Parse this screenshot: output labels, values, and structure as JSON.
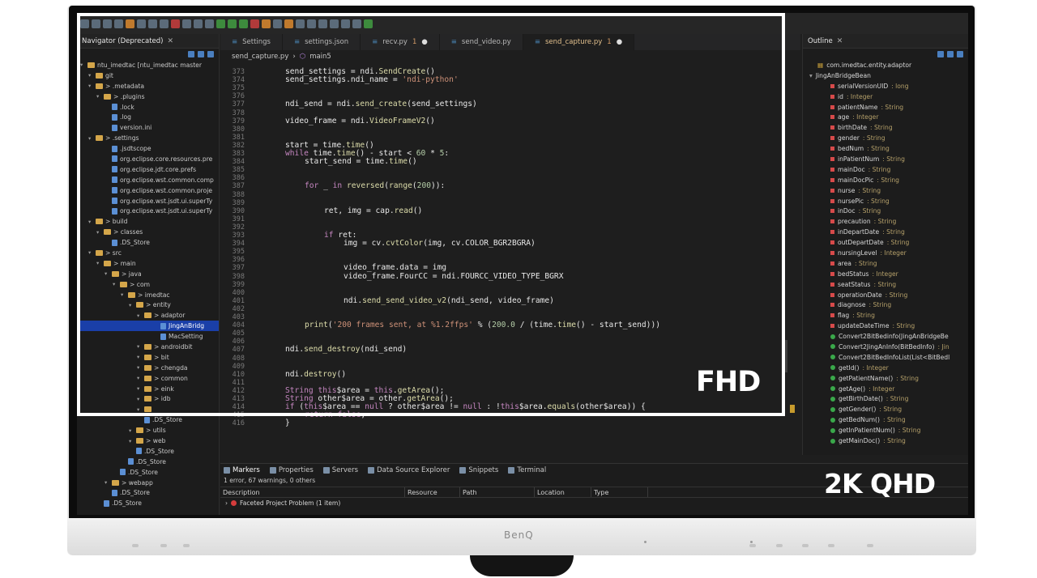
{
  "navigator": {
    "title": "Navigator (Deprecated)",
    "items": [
      {
        "label": "ntu_imedtac [ntu_imedtac master",
        "indent": 0,
        "kind": "project"
      },
      {
        "label": "git",
        "indent": 1,
        "kind": "folder"
      },
      {
        "label": "> .metadata",
        "indent": 1,
        "kind": "folder"
      },
      {
        "label": "> .plugins",
        "indent": 2,
        "kind": "folder"
      },
      {
        "label": ".lock",
        "indent": 3,
        "kind": "file"
      },
      {
        "label": ".log",
        "indent": 3,
        "kind": "file"
      },
      {
        "label": "version.ini",
        "indent": 3,
        "kind": "file"
      },
      {
        "label": "> .settings",
        "indent": 1,
        "kind": "folder"
      },
      {
        "label": ".jsdtscope",
        "indent": 3,
        "kind": "file"
      },
      {
        "label": "org.eclipse.core.resources.pre",
        "indent": 3,
        "kind": "file"
      },
      {
        "label": "org.eclipse.jdt.core.prefs",
        "indent": 3,
        "kind": "file"
      },
      {
        "label": "org.eclipse.wst.common.comp",
        "indent": 3,
        "kind": "file"
      },
      {
        "label": "org.eclipse.wst.common.proje",
        "indent": 3,
        "kind": "file"
      },
      {
        "label": "org.eclipse.wst.jsdt.ui.superTy",
        "indent": 3,
        "kind": "file"
      },
      {
        "label": "org.eclipse.wst.jsdt.ui.superTy",
        "indent": 3,
        "kind": "file"
      },
      {
        "label": "> build",
        "indent": 1,
        "kind": "folder"
      },
      {
        "label": "> classes",
        "indent": 2,
        "kind": "folder"
      },
      {
        "label": ".DS_Store",
        "indent": 3,
        "kind": "file"
      },
      {
        "label": "> src",
        "indent": 1,
        "kind": "folder"
      },
      {
        "label": "> main",
        "indent": 2,
        "kind": "folder"
      },
      {
        "label": "> java",
        "indent": 3,
        "kind": "folder"
      },
      {
        "label": "> com",
        "indent": 4,
        "kind": "folder"
      },
      {
        "label": "> imedtac",
        "indent": 5,
        "kind": "folder"
      },
      {
        "label": "> entity",
        "indent": 6,
        "kind": "folder"
      },
      {
        "label": "> adaptor",
        "indent": 7,
        "kind": "folder"
      },
      {
        "label": "JingAnBridg",
        "indent": 9,
        "kind": "file",
        "selected": true
      },
      {
        "label": "MacSetting",
        "indent": 9,
        "kind": "file"
      },
      {
        "label": "> androidbit",
        "indent": 7,
        "kind": "folder"
      },
      {
        "label": "> bit",
        "indent": 7,
        "kind": "folder"
      },
      {
        "label": "> chengda",
        "indent": 7,
        "kind": "folder"
      },
      {
        "label": "> common",
        "indent": 7,
        "kind": "folder"
      },
      {
        "label": "> eink",
        "indent": 7,
        "kind": "folder"
      },
      {
        "label": "> idb",
        "indent": 7,
        "kind": "folder"
      },
      {
        "label": "",
        "indent": 7,
        "kind": "folder"
      },
      {
        "label": ".DS_Store",
        "indent": 7,
        "kind": "file"
      },
      {
        "label": "> utils",
        "indent": 6,
        "kind": "folder"
      },
      {
        "label": "> web",
        "indent": 6,
        "kind": "folder"
      },
      {
        "label": ".DS_Store",
        "indent": 6,
        "kind": "file"
      },
      {
        "label": ".DS_Store",
        "indent": 5,
        "kind": "file"
      },
      {
        "label": ".DS_Store",
        "indent": 4,
        "kind": "file"
      },
      {
        "label": "> webapp",
        "indent": 3,
        "kind": "folder"
      },
      {
        "label": ".DS_Store",
        "indent": 3,
        "kind": "file"
      },
      {
        "label": ".DS_Store",
        "indent": 2,
        "kind": "file"
      }
    ]
  },
  "tabs": [
    {
      "label": "Settings",
      "active": false,
      "badge": "",
      "dot": false
    },
    {
      "label": "settings.json",
      "active": false,
      "badge": "",
      "dot": false
    },
    {
      "label": "recv.py",
      "active": false,
      "badge": "1",
      "dot": true
    },
    {
      "label": "send_video.py",
      "active": false,
      "badge": "",
      "dot": false
    },
    {
      "label": "send_capture.py",
      "active": true,
      "badge": "1",
      "dot": true
    }
  ],
  "breadcrumb": {
    "file": "send_capture.py",
    "symbol": "main5"
  },
  "code": [
    {
      "ln": "373",
      "indent": 2,
      "text": "send_settings = ndi.SendCreate()"
    },
    {
      "ln": "374",
      "indent": 2,
      "text": "send_settings.ndi_name = 'ndi-python'"
    },
    {
      "ln": "375",
      "indent": 0,
      "text": ""
    },
    {
      "ln": "376",
      "indent": 0,
      "text": ""
    },
    {
      "ln": "377",
      "indent": 2,
      "text": "ndi_send = ndi.send_create(send_settings)"
    },
    {
      "ln": "378",
      "indent": 0,
      "text": ""
    },
    {
      "ln": "379",
      "indent": 2,
      "text": "video_frame = ndi.VideoFrameV2()"
    },
    {
      "ln": "380",
      "indent": 0,
      "text": ""
    },
    {
      "ln": "381",
      "indent": 0,
      "text": ""
    },
    {
      "ln": "382",
      "indent": 2,
      "text": "start = time.time()"
    },
    {
      "ln": "383",
      "indent": 2,
      "text": "while time.time() - start < 60 * 5:"
    },
    {
      "ln": "384",
      "indent": 3,
      "text": "start_send = time.time()"
    },
    {
      "ln": "385",
      "indent": 0,
      "text": ""
    },
    {
      "ln": "386",
      "indent": 0,
      "text": ""
    },
    {
      "ln": "387",
      "indent": 3,
      "text": "for _ in reversed(range(200)):"
    },
    {
      "ln": "388",
      "indent": 0,
      "text": ""
    },
    {
      "ln": "389",
      "indent": 0,
      "text": ""
    },
    {
      "ln": "390",
      "indent": 4,
      "text": "ret, img = cap.read()"
    },
    {
      "ln": "391",
      "indent": 0,
      "text": ""
    },
    {
      "ln": "392",
      "indent": 0,
      "text": ""
    },
    {
      "ln": "393",
      "indent": 4,
      "text": "if ret:"
    },
    {
      "ln": "394",
      "indent": 5,
      "text": "img = cv.cvtColor(img, cv.COLOR_BGR2BGRA)"
    },
    {
      "ln": "395",
      "indent": 0,
      "text": ""
    },
    {
      "ln": "396",
      "indent": 0,
      "text": ""
    },
    {
      "ln": "397",
      "indent": 5,
      "text": "video_frame.data = img"
    },
    {
      "ln": "398",
      "indent": 5,
      "text": "video_frame.FourCC = ndi.FOURCC_VIDEO_TYPE_BGRX"
    },
    {
      "ln": "399",
      "indent": 0,
      "text": ""
    },
    {
      "ln": "400",
      "indent": 0,
      "text": ""
    },
    {
      "ln": "401",
      "indent": 5,
      "text": "ndi.send_send_video_v2(ndi_send, video_frame)"
    },
    {
      "ln": "402",
      "indent": 0,
      "text": ""
    },
    {
      "ln": "403",
      "indent": 0,
      "text": ""
    },
    {
      "ln": "404",
      "indent": 3,
      "text": "print('200 frames sent, at %1.2ffps' % (200.0 / (time.time() - start_send)))"
    },
    {
      "ln": "405",
      "indent": 0,
      "text": ""
    },
    {
      "ln": "406",
      "indent": 0,
      "text": ""
    },
    {
      "ln": "407",
      "indent": 2,
      "text": "ndi.send_destroy(ndi_send)"
    },
    {
      "ln": "408",
      "indent": 0,
      "text": ""
    },
    {
      "ln": "409",
      "indent": 0,
      "text": ""
    },
    {
      "ln": "410",
      "indent": 2,
      "text": "ndi.destroy()"
    },
    {
      "ln": "411",
      "indent": 0,
      "text": ""
    },
    {
      "ln": "412",
      "indent": 2,
      "text": "String this$area = this.getArea();"
    },
    {
      "ln": "413",
      "indent": 2,
      "text": "String other$area = other.getArea();"
    },
    {
      "ln": "414",
      "indent": 2,
      "text": "if (this$area == null ? other$area != null : !this$area.equals(other$area)) {"
    },
    {
      "ln": "415",
      "indent": 3,
      "text": "return false;"
    },
    {
      "ln": "416",
      "indent": 2,
      "text": "}"
    }
  ],
  "outline": {
    "title": "Outline",
    "items": [
      {
        "name": "com.imedtac.entity.adaptor",
        "type": "",
        "kind": "pkg"
      },
      {
        "name": "JingAnBridgeBean",
        "type": "",
        "kind": "class"
      },
      {
        "name": "serialVersionUID",
        "type": ": long",
        "kind": "field"
      },
      {
        "name": "id",
        "type": ": Integer",
        "kind": "field"
      },
      {
        "name": "patientName",
        "type": ": String",
        "kind": "field"
      },
      {
        "name": "age",
        "type": ": Integer",
        "kind": "field"
      },
      {
        "name": "birthDate",
        "type": ": String",
        "kind": "field"
      },
      {
        "name": "gender",
        "type": ": String",
        "kind": "field"
      },
      {
        "name": "bedNum",
        "type": ": String",
        "kind": "field"
      },
      {
        "name": "inPatientNum",
        "type": ": String",
        "kind": "field"
      },
      {
        "name": "mainDoc",
        "type": ": String",
        "kind": "field"
      },
      {
        "name": "mainDocPic",
        "type": ": String",
        "kind": "field"
      },
      {
        "name": "nurse",
        "type": ": String",
        "kind": "field"
      },
      {
        "name": "nursePic",
        "type": ": String",
        "kind": "field"
      },
      {
        "name": "inDoc",
        "type": ": String",
        "kind": "field"
      },
      {
        "name": "precaution",
        "type": ": String",
        "kind": "field"
      },
      {
        "name": "inDepartDate",
        "type": ": String",
        "kind": "field"
      },
      {
        "name": "outDepartDate",
        "type": ": String",
        "kind": "field"
      },
      {
        "name": "nursingLevel",
        "type": ": Integer",
        "kind": "field"
      },
      {
        "name": "area",
        "type": ": String",
        "kind": "field"
      },
      {
        "name": "bedStatus",
        "type": ": Integer",
        "kind": "field"
      },
      {
        "name": "seatStatus",
        "type": ": String",
        "kind": "field"
      },
      {
        "name": "operationDate",
        "type": ": String",
        "kind": "field"
      },
      {
        "name": "diagnose",
        "type": ": String",
        "kind": "field"
      },
      {
        "name": "flag",
        "type": ": String",
        "kind": "field"
      },
      {
        "name": "updateDateTime",
        "type": ": String",
        "kind": "field"
      },
      {
        "name": "Convert2BitBedinfo(JingAnBridgeBe",
        "type": "",
        "kind": "method"
      },
      {
        "name": "Convert2JingAnInfo(BitBedInfo)",
        "type": ": Jin",
        "kind": "method"
      },
      {
        "name": "Convert2BitBedInfoList(List<BitBedl",
        "type": "",
        "kind": "method"
      },
      {
        "name": "getId()",
        "type": ": Integer",
        "kind": "method"
      },
      {
        "name": "getPatientName()",
        "type": ": String",
        "kind": "method"
      },
      {
        "name": "getAge()",
        "type": ": Integer",
        "kind": "method"
      },
      {
        "name": "getBirthDate()",
        "type": ": String",
        "kind": "method"
      },
      {
        "name": "getGender()",
        "type": ": String",
        "kind": "method"
      },
      {
        "name": "getBedNum()",
        "type": ": String",
        "kind": "method"
      },
      {
        "name": "getInPatientNum()",
        "type": ": String",
        "kind": "method"
      },
      {
        "name": "getMainDoc()",
        "type": ": String",
        "kind": "method"
      }
    ]
  },
  "markers": {
    "tabs": [
      "Markers",
      "Properties",
      "Servers",
      "Data Source Explorer",
      "Snippets",
      "Terminal"
    ],
    "summary": "1 error, 67 warnings, 0 others",
    "columns": [
      "Description",
      "Resource",
      "Path",
      "Location",
      "Type"
    ],
    "rows": [
      "Faceted Project Problem (1 item)"
    ]
  },
  "labels": {
    "fhd": "FHD",
    "qhd": "2K QHD",
    "brand": "BenQ"
  },
  "colors": {
    "selection": "#1a3fa8",
    "frame": "#ffffff",
    "bezel": "#0c0c0c"
  }
}
